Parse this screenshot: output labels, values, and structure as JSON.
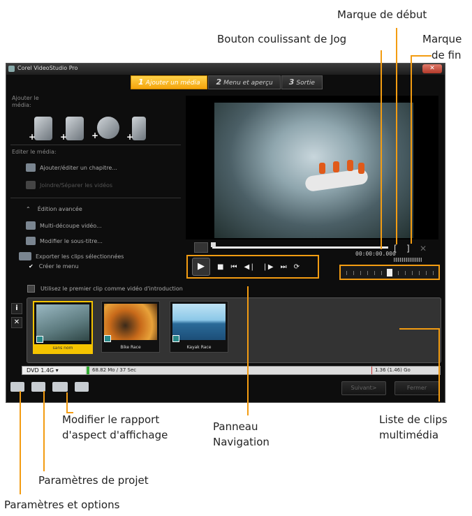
{
  "callouts": {
    "start_mark": "Marque de début",
    "jog": "Bouton coulissant de Jog",
    "end_mark_1": "Marque",
    "end_mark_2": "de fin",
    "aspect_1": "Modifier le rapport",
    "aspect_2": "d'aspect d'affichage",
    "nav_1": "Panneau",
    "nav_2": "Navigation",
    "clips_1": "Liste de clips",
    "clips_2": "multimédia",
    "project": "Paramètres de projet",
    "settings": "Paramètres et options"
  },
  "window": {
    "title": "Corel VideoStudio Pro",
    "close": "✕"
  },
  "tabs": [
    {
      "num": "1",
      "label": "Ajouter un média",
      "active": true
    },
    {
      "num": "2",
      "label": "Menu et aperçu",
      "active": false
    },
    {
      "num": "3",
      "label": "Sortie",
      "active": false
    }
  ],
  "left": {
    "add_media_1": "Ajouter le",
    "add_media_2": "média:",
    "edit_media": "Editer le média:",
    "chapter": "Ajouter/éditer un chapitre...",
    "join_split": "Joindre/Séparer les vidéos",
    "advanced": "Édition avancée",
    "multicut": "Multi-découpe vidéo...",
    "subtitle": "Modifier le sous-titre...",
    "export": "Exporter les clips sélectionnées",
    "create_menu": "Créer le menu"
  },
  "player": {
    "timecode": "00:00:00.000",
    "mark_in": "[",
    "mark_out": "]",
    "clear": "✕"
  },
  "nav": {
    "play": "▶",
    "stop": "■",
    "home": "⏮",
    "prev": "◀❘",
    "next": "❘▶",
    "end": "⏭",
    "repeat": "⟳"
  },
  "intro": "Utilisez le premier clip comme vidéo d'introduction",
  "clips": [
    {
      "caption": "sans nom",
      "selected": true
    },
    {
      "caption": "Bike Race",
      "selected": false
    },
    {
      "caption": "Kayak Race",
      "selected": false
    }
  ],
  "storage": {
    "disc": "DVD 1.4G",
    "used": "68.82 Mo / 37 Sec",
    "capacity": "1.36 (1.46) Go"
  },
  "buttons": {
    "next": "Suivant>",
    "close": "Fermer"
  },
  "colors": {
    "accent": "#f39c12",
    "selected_clip": "#f5c400"
  }
}
